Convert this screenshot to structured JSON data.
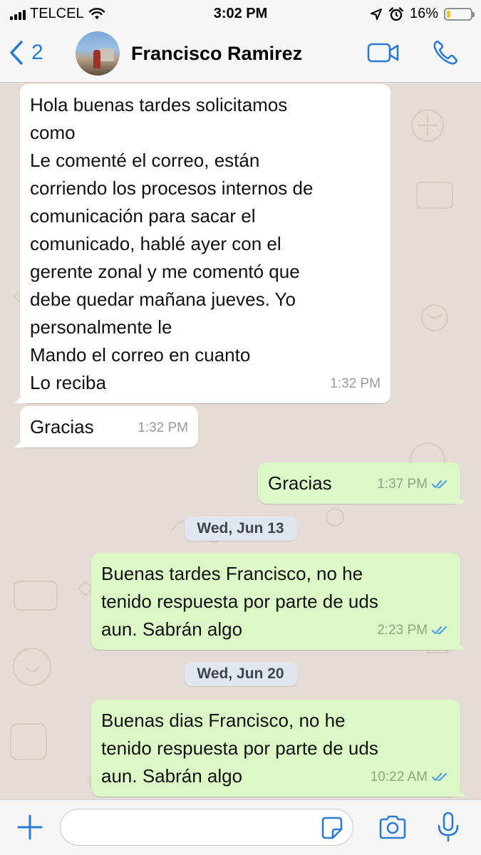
{
  "status_bar": {
    "carrier": "TELCEL",
    "time": "3:02 PM",
    "battery": "16%",
    "battery_level": 0.16
  },
  "header": {
    "back_count": "2",
    "contact_name": "Francisco Ramirez"
  },
  "messages": [
    {
      "direction": "incoming",
      "lines": [
        "Hola buenas tardes solicitamos",
        "como",
        "Le comenté el correo, están",
        "corriendo los procesos internos de",
        "comunicación para sacar el",
        "comunicado, hablé ayer con el",
        "gerente zonal y me comentó que",
        "debe quedar mañana jueves. Yo",
        "personalmente le",
        "Mando el correo en cuanto",
        "Lo reciba"
      ],
      "time": "1:32 PM"
    },
    {
      "direction": "incoming",
      "lines": [
        "Gracias"
      ],
      "time": "1:32 PM"
    },
    {
      "direction": "outgoing",
      "lines": [
        "Gracias"
      ],
      "time": "1:37 PM",
      "read": true
    },
    {
      "direction": "outgoing",
      "lines": [
        "Buenas tardes Francisco, no he",
        "tenido respuesta por parte de uds",
        "aun. Sabrán algo"
      ],
      "time": "2:23 PM",
      "read": true
    },
    {
      "direction": "outgoing",
      "lines": [
        "Buenas dias Francisco, no he",
        "tenido respuesta por parte de uds",
        "aun. Sabrán algo"
      ],
      "time": "10:22 AM",
      "read": true
    }
  ],
  "date_separators": [
    "Wed, Jun 13",
    "Wed, Jun 20"
  ],
  "colors": {
    "accent": "#2a7bd6",
    "incoming_bubble": "#ffffff",
    "outgoing_bubble": "#dcf8c6",
    "read_ticks": "#4fa3e0",
    "chat_background": "#e5ddd5"
  }
}
